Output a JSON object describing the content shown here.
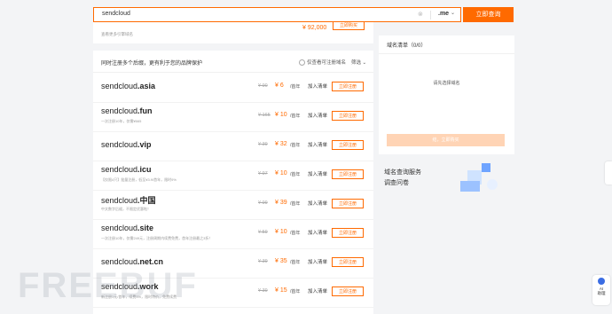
{
  "search": {
    "value": "sendcloud",
    "clear_icon": "clear-icon",
    "tld": ".me",
    "button": "立即查询"
  },
  "top_card": {
    "price": "¥ 92,000",
    "button": "立即购买",
    "note": "查看更多引擎域名"
  },
  "list": {
    "heading": "同时注册多个后缀，更有利于您的品牌保护",
    "checkbox_label": "仅查看可注册域名",
    "filter": "筛选",
    "rows": [
      {
        "name": "sendcloud",
        "suffix": ".asia",
        "desc": "",
        "orig": "¥ 90",
        "cur": "¥ 6",
        "unit": "/首年",
        "add": "加入清单",
        "reg": "立即注册"
      },
      {
        "name": "sendcloud",
        "suffix": ".fun",
        "desc": "一次注册10年，仅需¥665",
        "orig": "¥ 165",
        "cur": "¥ 10",
        "unit": "/首年",
        "add": "加入清单",
        "reg": "立即注册"
      },
      {
        "name": "sendcloud",
        "suffix": ".vip",
        "desc": "",
        "orig": "¥ 39",
        "cur": "¥ 32",
        "unit": "/首年",
        "add": "加入清单",
        "reg": "立即注册"
      },
      {
        "name": "sendcloud",
        "suffix": ".icu",
        "desc": "【仅限4只】批量注册，低至¥3.9/首年，限时9%",
        "orig": "¥ 97",
        "cur": "¥ 10",
        "unit": "/首年",
        "add": "加入清单",
        "reg": "立即注册"
      },
      {
        "name": "sendcloud",
        "suffix": ".中国",
        "desc": "中文数字后缀，不限定优惠啦！",
        "orig": "¥ 99",
        "cur": "¥ 39",
        "unit": "/首年",
        "add": "加入清单",
        "reg": "立即注册"
      },
      {
        "name": "sendcloud",
        "suffix": ".site",
        "desc": "一次注册10年，仅需249元，注册周期内续费免费，首年注册最之3折！",
        "orig": "¥ 59",
        "cur": "¥ 10",
        "unit": "/首年",
        "add": "加入清单",
        "reg": "立即注册"
      },
      {
        "name": "sendcloud",
        "suffix": ".net.cn",
        "desc": "",
        "orig": "¥ 39",
        "cur": "¥ 35",
        "unit": "/首年",
        "add": "加入清单",
        "reg": "立即注册"
      },
      {
        "name": "sendcloud",
        "suffix": ".work",
        "desc": "新注册1元/首年，续费5%，限时特价，免费续费",
        "orig": "¥ 39",
        "cur": "¥ 15",
        "unit": "/首年",
        "add": "加入清单",
        "reg": "立即注册"
      }
    ]
  },
  "cart": {
    "title": "域名清单（0/0）",
    "empty": "请先选择域名",
    "button": "结，立即购买"
  },
  "survey": {
    "line1": "域名查询服务",
    "line2": "调查问卷"
  },
  "ai": {
    "label1": "AI",
    "label2": "助理"
  },
  "watermark": "FREEBUF",
  "colors": {
    "accent": "#ff6a00",
    "background": "#f3f4f6"
  }
}
